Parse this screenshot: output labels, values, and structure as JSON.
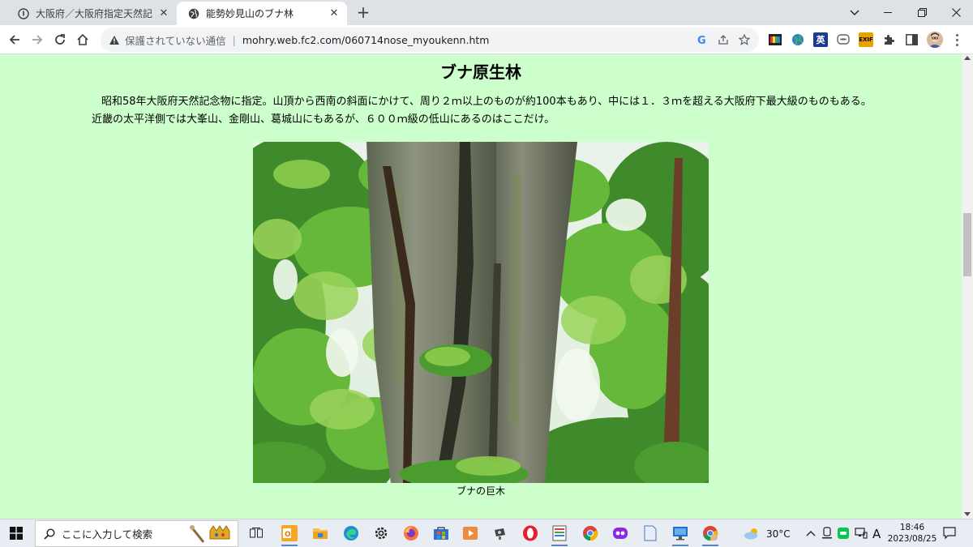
{
  "browser": {
    "tabs": [
      {
        "title": "大阪府／大阪府指定天然記念物",
        "active": false
      },
      {
        "title": "能勢妙見山のブナ林",
        "active": true
      }
    ],
    "address": {
      "security_label": "保護されていない通信",
      "url": "mohry.web.fc2.com/060714nose_myoukenn.htm"
    },
    "extensions": {
      "eng_label": "英",
      "exif_label": "EXIF"
    }
  },
  "page": {
    "background": "#ccffcc",
    "title": "ブナ原生林",
    "paragraph_line1": "昭和58年大阪府天然記念物に指定。山頂から西南の斜面にかけて、周り２ｍ以上のものが約100本もあり、中には１．３ｍを超える大阪府下最大級のものもある。",
    "paragraph_line2": "近畿の太平洋側では大峯山、金剛山、葛城山にもあるが、６００ｍ級の低山にあるのはここだけ。",
    "photo_caption": "ブナの巨木"
  },
  "taskbar": {
    "search_placeholder": "ここに入力して検索",
    "weather": "30°C",
    "ime": "A",
    "time": "18:46",
    "date": "2023/08/25"
  }
}
